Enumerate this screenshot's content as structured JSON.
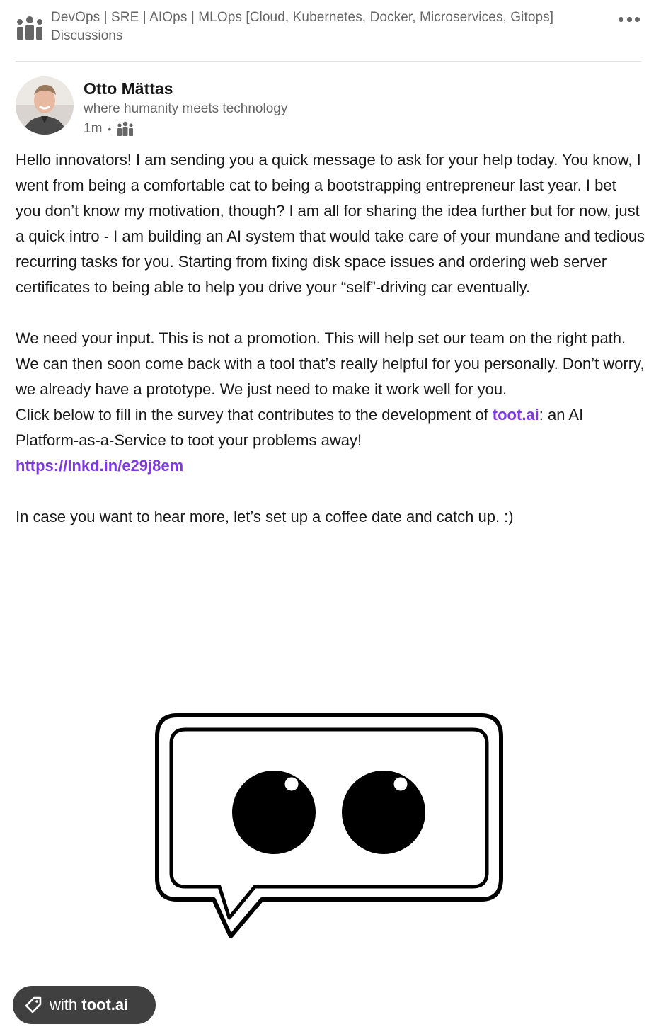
{
  "group": {
    "title": "DevOps | SRE | AIOps | MLOps [Cloud, Kubernetes, Docker, Microservices, Gitops]",
    "subtitle": "Discussions",
    "icon": "group-icon",
    "more_icon": "more-options-icon"
  },
  "author": {
    "name": "Otto Mättas",
    "headline": "where humanity meets technology",
    "time": "1m",
    "separator": "•",
    "visibility_icon": "group-visibility-icon"
  },
  "post": {
    "paragraph1": "Hello innovators! I am sending you a quick message to ask for your help today. You know, I went from being a comfortable cat to being a bootstrapping entrepreneur last year. I bet you don’t know my motivation, though? I am all for sharing the idea further but for now, just a quick intro - I am building an AI system that would take care of your mundane and tedious recurring tasks for you. Starting from fixing disk space issues and ordering web server certificates to being able to help you drive your “self”-driving car eventually.",
    "paragraph2": "We need your input. This is not a promotion. This will help set our team on the right path. We can then soon come back with a tool that’s really helpful for you personally. Don’t worry, we already have a prototype. We just need to make it work well for you.",
    "survey_prefix": "Click below to fill in the survey that contributes to the development of ",
    "company_link": "toot.ai",
    "survey_suffix": ": an AI Platform-as-a-Service to toot your problems away!",
    "survey_link": "https://lnkd.in/e29j8em",
    "closing": "In case you want to hear more, let’s set up a coffee date and catch up. :)"
  },
  "image": {
    "description_icon": "speech-bubble-eyes-logo"
  },
  "tag": {
    "prefix": "with ",
    "brand": "toot.ai",
    "icon": "tag-icon"
  },
  "colors": {
    "link": "#7e3ae0",
    "muted": "#666666",
    "pill": "#404040"
  }
}
